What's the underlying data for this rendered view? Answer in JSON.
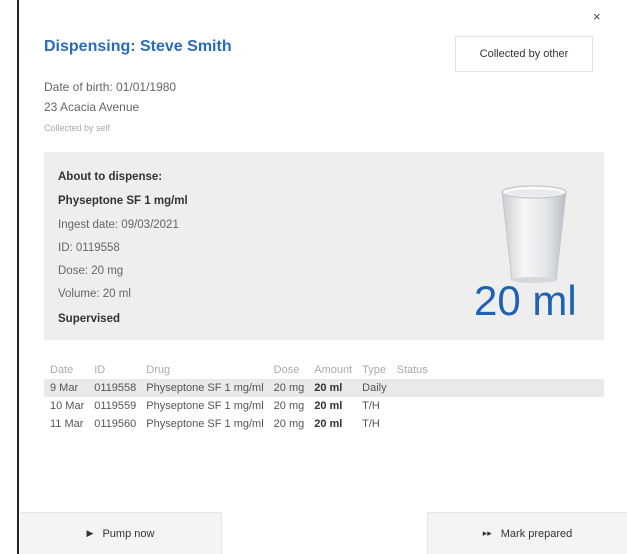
{
  "dialog": {
    "close_glyph": "×",
    "title": "Dispensing: Steve Smith",
    "collected_by_other_label": "Collected by other"
  },
  "patient": {
    "dob": "Date of birth: 01/01/1980",
    "address": "23 Acacia Avenue",
    "collected_by": "Collected by self"
  },
  "about": {
    "heading": "About to dispense:",
    "drug": "Physeptone SF 1 mg/ml",
    "ingest_date": "Ingest date: 09/03/2021",
    "id": "ID: 0119558",
    "dose": "Dose: 20 mg",
    "volume": "Volume: 20 ml",
    "supervision": "Supervised",
    "big_volume": "20 ml",
    "cup_icon": "cup-icon"
  },
  "history": {
    "headers": [
      "Date",
      "ID",
      "Drug",
      "Dose",
      "Amount",
      "Type",
      "Status"
    ],
    "rows": [
      {
        "date": "9 Mar",
        "id": "0119558",
        "drug": "Physeptone SF 1 mg/ml",
        "dose": "20 mg",
        "amount": "20 ml",
        "type": "Daily",
        "status": ""
      },
      {
        "date": "10 Mar",
        "id": "0119559",
        "drug": "Physeptone SF 1 mg/ml",
        "dose": "20 mg",
        "amount": "20 ml",
        "type": "T/H",
        "status": ""
      },
      {
        "date": "11 Mar",
        "id": "0119560",
        "drug": "Physeptone SF 1 mg/ml",
        "dose": "20 mg",
        "amount": "20 ml",
        "type": "T/H",
        "status": ""
      }
    ],
    "highlight_row": 0
  },
  "footer": {
    "pump_glyph": "▶",
    "pump_label": "Pump now",
    "prepared_glyph": "▸▸",
    "prepared_label": "Mark prepared"
  },
  "colors": {
    "accent": "#2a6cb8",
    "big_volume": "#1e63b3",
    "panel_bg": "#eeeeee",
    "row_highlight": "#e9e9e9"
  }
}
